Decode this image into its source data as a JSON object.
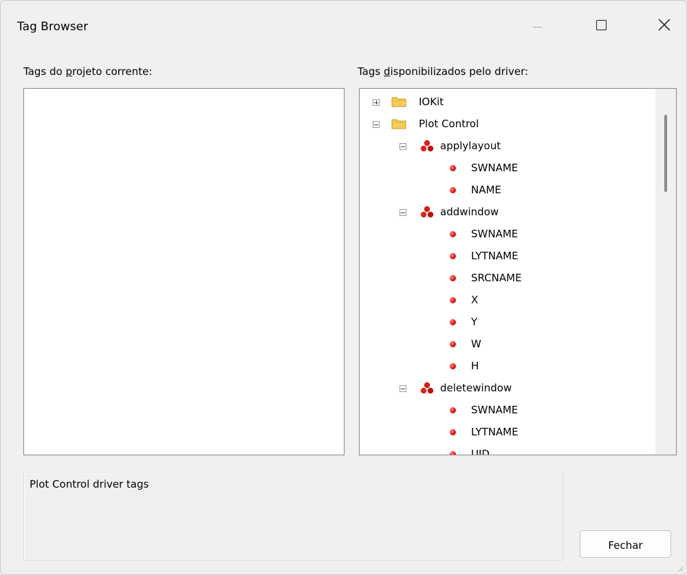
{
  "window": {
    "title": "Tag Browser"
  },
  "left_panel": {
    "label_pre": "Tags do ",
    "label_u": "p",
    "label_post": "rojeto corrente:"
  },
  "right_panel": {
    "label_pre": "Tags ",
    "label_u": "d",
    "label_post": "isponibilizados pelo driver:",
    "tree": {
      "iokit": "IOKit",
      "plot_control": "Plot Control",
      "applylayout": {
        "label": "applylayout",
        "tags": [
          "SWNAME",
          "NAME"
        ]
      },
      "addwindow": {
        "label": "addwindow",
        "tags": [
          "SWNAME",
          "LYTNAME",
          "SRCNAME",
          "X",
          "Y",
          "W",
          "H"
        ]
      },
      "deletewindow": {
        "label": "deletewindow",
        "tags": [
          "SWNAME",
          "LYTNAME",
          "UID"
        ]
      }
    }
  },
  "description": "Plot Control driver tags",
  "buttons": {
    "close": "Fechar"
  },
  "colors": {
    "tag_dot": "#e01818",
    "folder": "#f0c040",
    "border": "#828790"
  }
}
